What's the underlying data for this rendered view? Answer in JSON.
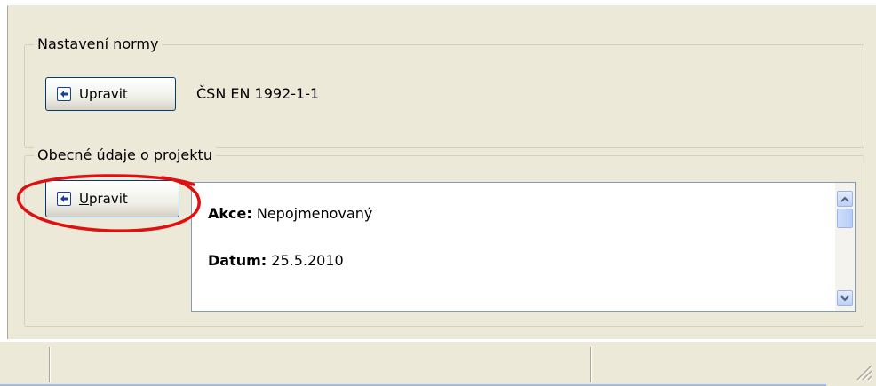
{
  "norm_group": {
    "title": "Nastavení normy",
    "edit_button": "Upravit",
    "norm_value": "ČSN EN 1992-1-1"
  },
  "project_group": {
    "title": "Obecné údaje o projektu",
    "edit_button_mnemonic": "U",
    "edit_button_rest": "pravit",
    "fields": [
      {
        "label": "Akce:",
        "value": "Nepojmenovaný"
      },
      {
        "label": "Datum:",
        "value": "25.5.2010"
      }
    ]
  },
  "colors": {
    "highlight": "#e01010",
    "button_border": "#003c74",
    "panel_bg": "#ece9d8"
  },
  "icons": {
    "button_icon": "enter-arrow-icon",
    "scroll_up": "chevron-up-icon",
    "scroll_down": "chevron-down-icon",
    "resize": "resize-grip-icon"
  }
}
